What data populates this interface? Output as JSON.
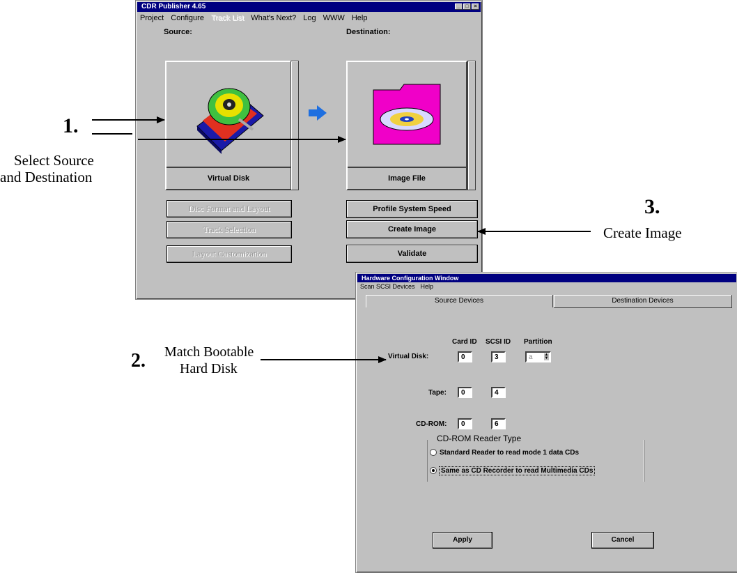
{
  "main_window": {
    "title": "CDR Publisher 4.65",
    "menu": [
      "Project",
      "Configure",
      "Track List",
      "What's Next?",
      "Log",
      "WWW",
      "Help"
    ],
    "source_label": "Source:",
    "destination_label": "Destination:",
    "source_caption": "Virtual Disk",
    "destination_caption": "Image File",
    "left_buttons": [
      "Disc Format and Layout",
      "Track Selection",
      "Layout Customization"
    ],
    "right_buttons": [
      "Profile System Speed",
      "Create Image",
      "Validate"
    ]
  },
  "hw_window": {
    "title": "Hardware Configuration Window",
    "menu": [
      "Scan SCSI Devices",
      "Help"
    ],
    "tabs": [
      "Source Devices",
      "Destination Devices"
    ],
    "col_headers": [
      "Card ID",
      "SCSI ID",
      "Partition"
    ],
    "rows": [
      {
        "label": "Virtual Disk:",
        "card": "0",
        "scsi": "3",
        "partition": "a"
      },
      {
        "label": "Tape:",
        "card": "0",
        "scsi": "4"
      },
      {
        "label": "CD-ROM:",
        "card": "0",
        "scsi": "6"
      }
    ],
    "reader_group_title": "CD-ROM Reader Type",
    "radio_options": [
      "Standard Reader to read mode 1 data CDs",
      "Same as CD Recorder to read Multimedia CDs"
    ],
    "apply_label": "Apply",
    "cancel_label": "Cancel"
  },
  "annotations": {
    "step1_num": "1.",
    "step1_text_line1": "Select Source",
    "step1_text_line2": "and Destination",
    "step2_num": "2.",
    "step2_text_line1": "Match Bootable",
    "step2_text_line2": "Hard Disk",
    "step3_num": "3.",
    "step3_text": "Create Image"
  },
  "colors": {
    "titlebar": "#000080",
    "window": "#c0c0c0",
    "arrow": "#1e6fe0"
  }
}
